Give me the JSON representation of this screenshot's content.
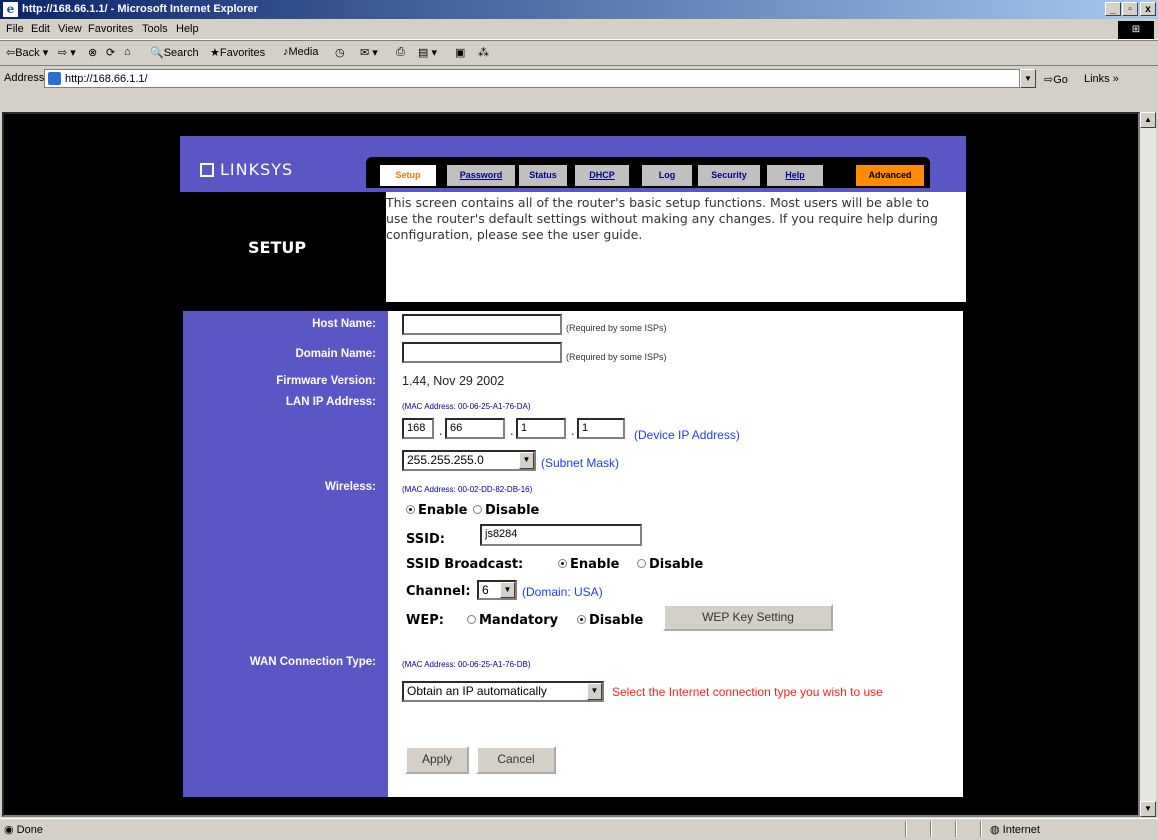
{
  "window": {
    "title": "http://168.66.1.1/ - Microsoft Internet Explorer",
    "caption_buttons": [
      "_",
      "▫",
      "x"
    ]
  },
  "menu": [
    "File",
    "Edit",
    "View",
    "Favorites",
    "Tools",
    "Help"
  ],
  "toolbar": {
    "back": "Back",
    "search": "Search",
    "favorites": "Favorites",
    "media": "Media"
  },
  "address": {
    "label": "Address",
    "url": "http://168.66.1.1/",
    "go": "Go",
    "links": "Links"
  },
  "page": {
    "brand": "LINKSYS",
    "tabs": [
      {
        "label": "Setup",
        "active": true
      },
      {
        "label": "Password"
      },
      {
        "label": "Status"
      },
      {
        "label": "DHCP"
      },
      {
        "label": "Log"
      },
      {
        "label": "Security"
      },
      {
        "label": "Help"
      },
      {
        "label": "Advanced"
      }
    ],
    "section_title": "SETUP",
    "intro": "This screen contains all of the router's basic setup functions. Most users will be able to use the router's default settings without making any changes. If you require help during configuration, please see the user guide.",
    "labels": {
      "host_name": "Host Name:",
      "domain_name": "Domain Name:",
      "firmware_version": "Firmware Version:",
      "lan_ip": "LAN IP Address:",
      "wireless": "Wireless:",
      "wan_type": "WAN Connection Type:"
    },
    "host_name": {
      "value": "",
      "hint": "(Required by some ISPs)"
    },
    "domain_name": {
      "value": "",
      "hint": "(Required by some ISPs)"
    },
    "firmware": "1.44, Nov 29 2002",
    "lan": {
      "mac": "(MAC Address: 00-06-25-A1-76-DA)",
      "ip": [
        "168",
        "66",
        "1",
        "1"
      ],
      "ip_note": "(Device IP Address)",
      "subnet": "255.255.255.0",
      "subnet_note": "(Subnet Mask)"
    },
    "wireless": {
      "mac": "(MAC Address: 00-02-DD-82-DB-16)",
      "enable": "Enable",
      "disable": "Disable",
      "ssid_label": "SSID:",
      "ssid": "js8284",
      "broadcast_label": "SSID Broadcast:",
      "broadcast_enable": "Enable",
      "broadcast_disable": "Disable",
      "channel_label": "Channel:",
      "channel": "6",
      "domain_note": "(Domain: USA)",
      "wep_label": "WEP:",
      "wep_mandatory": "Mandatory",
      "wep_disable": "Disable",
      "wep_button": "WEP Key Setting"
    },
    "wan": {
      "mac": "(MAC Address: 00-06-25-A1-76-DB)",
      "type": "Obtain an IP automatically",
      "note": "Select the Internet connection type you wish to use"
    },
    "apply": "Apply",
    "cancel": "Cancel"
  },
  "status": {
    "text": "Done",
    "zone": "Internet"
  }
}
